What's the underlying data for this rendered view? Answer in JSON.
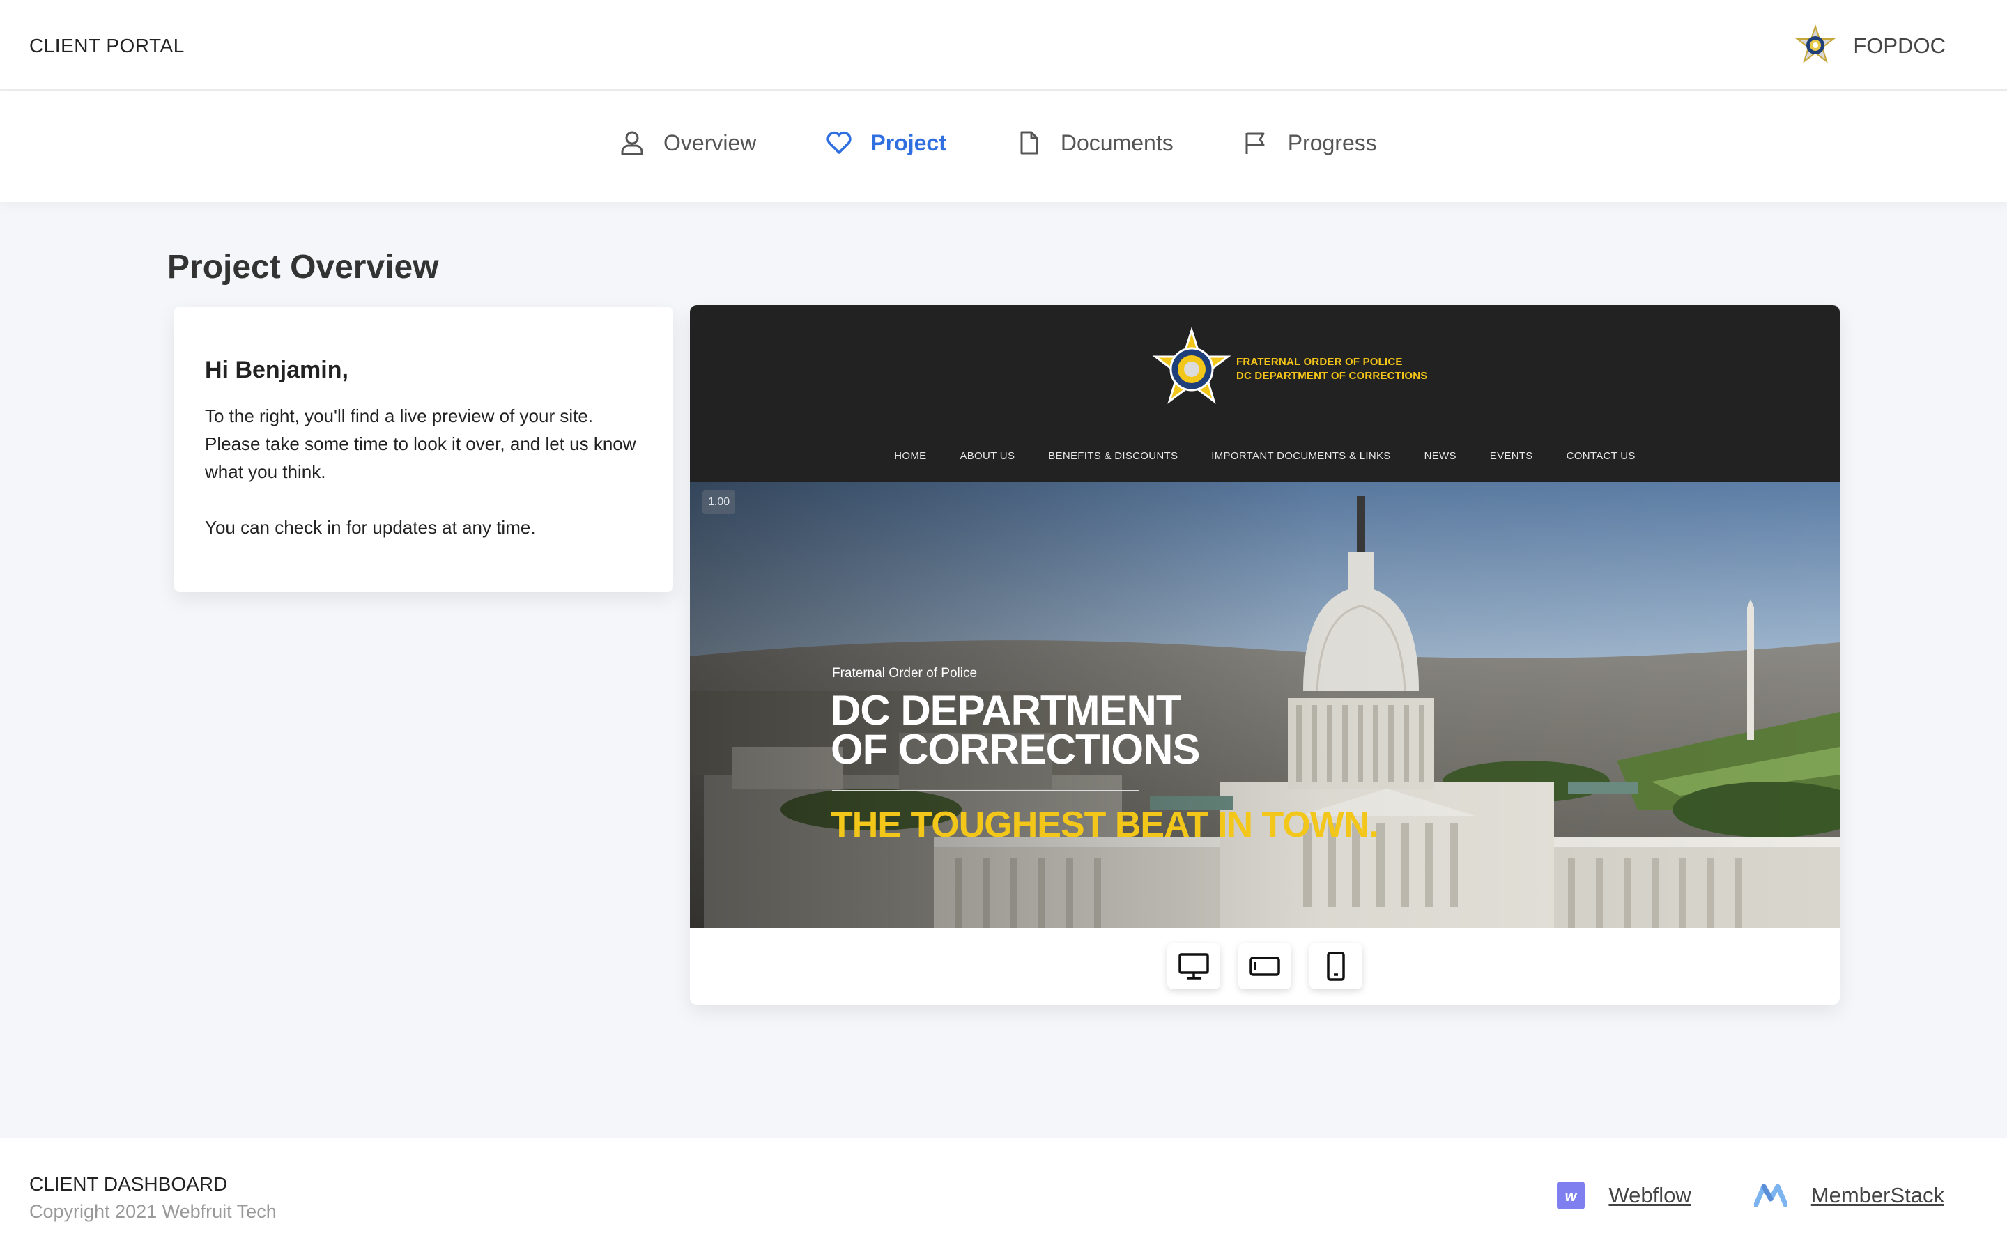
{
  "header": {
    "brand": "CLIENT PORTAL",
    "org_name": "FOPDOC",
    "org_logo_icon": "fop-star-badge-icon"
  },
  "tabs": [
    {
      "label": "Overview",
      "icon": "user-icon",
      "active": false
    },
    {
      "label": "Project",
      "icon": "heart-icon",
      "active": true
    },
    {
      "label": "Documents",
      "icon": "document-icon",
      "active": false
    },
    {
      "label": "Progress",
      "icon": "flag-icon",
      "active": false
    }
  ],
  "main": {
    "title": "Project Overview",
    "intro": {
      "greeting": "Hi Benjamin,",
      "paragraph1": "To the right, you'll find a live preview of your site. Please take some time to look it over, and let us know what you think.",
      "paragraph2": "You can check in for updates at any time."
    }
  },
  "preview": {
    "logo_line1": "FRATERNAL ORDER OF POLICE",
    "logo_line2": "DC DEPARTMENT OF CORRECTIONS",
    "menu": [
      "HOME",
      "ABOUT US",
      "BENEFITS & DISCOUNTS",
      "IMPORTANT DOCUMENTS & LINKS",
      "NEWS",
      "EVENTS",
      "CONTACT US"
    ],
    "zoom": "1.00",
    "hero_eyebrow": "Fraternal Order of Police",
    "hero_title": "DC DEPARTMENT OF CORRECTIONS",
    "hero_tagline": "THE TOUGHEST BEAT IN TOWN.",
    "accent_color": "#f3c71a",
    "devices": [
      "desktop-icon",
      "tablet-icon",
      "phone-icon"
    ]
  },
  "footer": {
    "title": "CLIENT DASHBOARD",
    "copyright": "Copyright 2021 Webfruit Tech",
    "links": [
      {
        "label": "Webflow",
        "icon": "webflow-icon"
      },
      {
        "label": "MemberStack",
        "icon": "memberstack-icon"
      }
    ]
  },
  "colors": {
    "active_tab": "#2f6fe0",
    "page_bg": "#f5f6fa",
    "site_header_bg": "#222222"
  }
}
